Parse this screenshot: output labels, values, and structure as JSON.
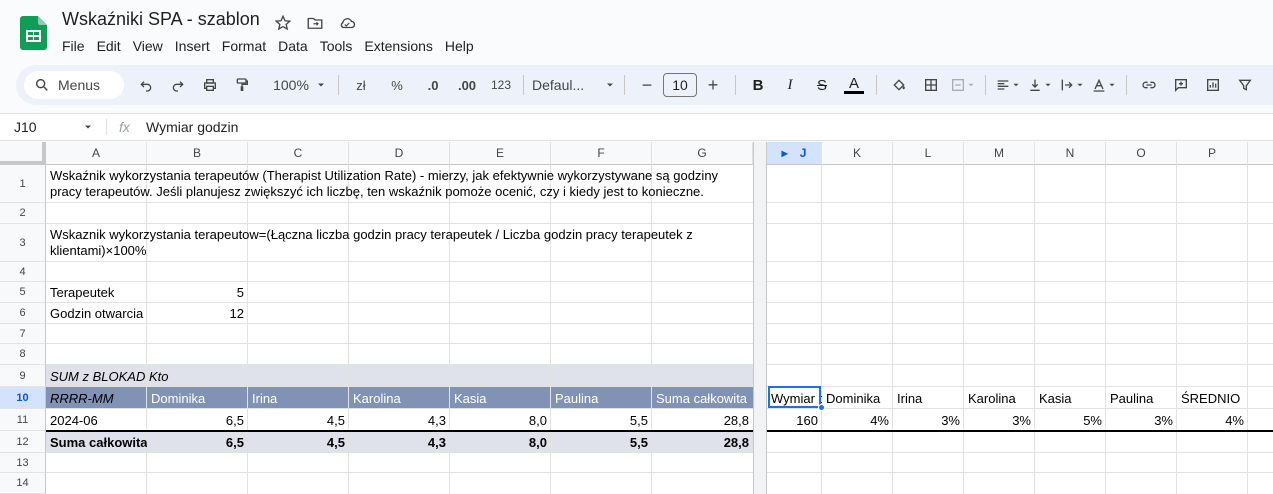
{
  "app": {
    "doc_title": "Wskaźniki SPA - szablon",
    "menus": [
      "File",
      "Edit",
      "View",
      "Insert",
      "Format",
      "Data",
      "Tools",
      "Extensions",
      "Help"
    ]
  },
  "toolbar": {
    "search_label": "Menus",
    "zoom": "100%",
    "currency": "zł",
    "percent": "%",
    "dec_decrease": ".0",
    "dec_increase": ".00",
    "number_format": "123",
    "font": "Defaul...",
    "font_size": "10",
    "minus": "−",
    "plus": "+"
  },
  "formula_bar": {
    "cell_ref": "J10",
    "fx": "fx",
    "content": "Wymiar godzin"
  },
  "columns": [
    "A",
    "B",
    "C",
    "D",
    "E",
    "F",
    "G",
    "J",
    "K",
    "L",
    "M",
    "N",
    "O",
    "P"
  ],
  "rows": [
    "1",
    "2",
    "3",
    "4",
    "5",
    "6",
    "7",
    "8",
    "9",
    "10",
    "11",
    "12",
    "13",
    "14"
  ],
  "cells": {
    "a1": "Wskaźnik wykorzystania terapeutów (Therapist Utilization Rate) - mierzy, jak efektywnie wykorzystywane są godziny pracy terapeutów. Jeśli planujesz zwiększyć ich liczbę, ten wskaźnik pomoże ocenić, czy i kiedy jest to konieczne.",
    "a3": "Wskaznik wykorzystania terapeutow=(Łączna liczba godzin pracy terapeutek / Liczba godzin pracy terapeutek z klientami)×100%",
    "a5": "Terapeutek",
    "b5": "5",
    "a6": "Godzin otwarcia",
    "b6": "12",
    "a9": "SUM z BLOKAD Kto",
    "a10": "RRRR-MM",
    "pivot_headers": [
      "Dominika",
      "Irina",
      "Karolina",
      "Kasia",
      "Paulina",
      "Suma całkowita"
    ],
    "a11": "2024-06",
    "row11_values": [
      "6,5",
      "4,5",
      "4,3",
      "8,0",
      "5,5",
      "28,8"
    ],
    "a12": "Suma całkowita",
    "row12_values": [
      "6,5",
      "4,5",
      "4,3",
      "8,0",
      "5,5",
      "28,8"
    ],
    "j10": "Wymiar godzin",
    "right_headers": [
      "Dominika",
      "Irina",
      "Karolina",
      "Kasia",
      "Paulina",
      "ŚREDNIO"
    ],
    "j11": "160",
    "right_values": [
      "4%",
      "3%",
      "3%",
      "5%",
      "3%",
      "4%"
    ]
  }
}
